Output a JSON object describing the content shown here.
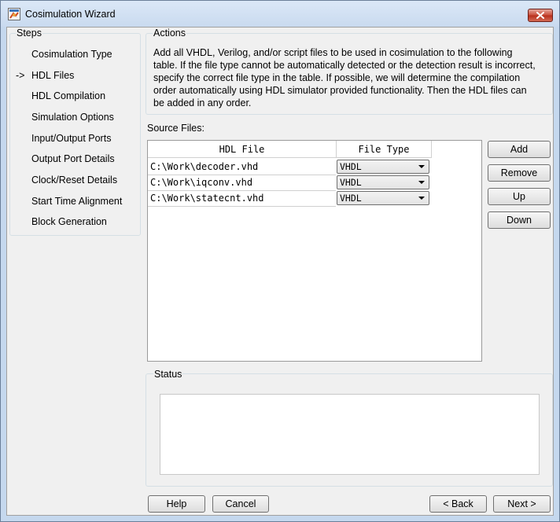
{
  "window": {
    "title": "Cosimulation Wizard"
  },
  "steps": {
    "title": "Steps",
    "current_marker": "->",
    "items": [
      "Cosimulation Type",
      "HDL Files",
      "HDL Compilation",
      "Simulation Options",
      "Input/Output Ports",
      "Output Port Details",
      "Clock/Reset Details",
      "Start Time Alignment",
      "Block Generation"
    ]
  },
  "actions": {
    "title": "Actions",
    "text": "Add all VHDL, Verilog, and/or script files to be used in cosimulation to the following table. If the file type cannot be automatically detected or the detection result is incorrect, specify the correct file type in the table. If possible, we will determine the compilation order automatically using HDL simulator provided functionality. Then the HDL files can be added in any order."
  },
  "source_files": {
    "label": "Source Files:",
    "columns": [
      "HDL File",
      "File Type"
    ],
    "rows": [
      {
        "file": "C:\\Work\\decoder.vhd",
        "type": "VHDL"
      },
      {
        "file": "C:\\Work\\iqconv.vhd",
        "type": "VHDL"
      },
      {
        "file": "C:\\Work\\statecnt.vhd",
        "type": "VHDL"
      }
    ],
    "buttons": {
      "add": "Add",
      "remove": "Remove",
      "up": "Up",
      "down": "Down"
    }
  },
  "status": {
    "title": "Status",
    "text": ""
  },
  "footer": {
    "help": "Help",
    "cancel": "Cancel",
    "back": "< Back",
    "next": "Next >"
  },
  "colors": {
    "titlebar": "#c9daef",
    "close_button": "#c94b38",
    "panel": "#f0f0f0"
  },
  "icons": [
    "app-icon",
    "close-icon",
    "dropdown-caret-icon"
  ]
}
